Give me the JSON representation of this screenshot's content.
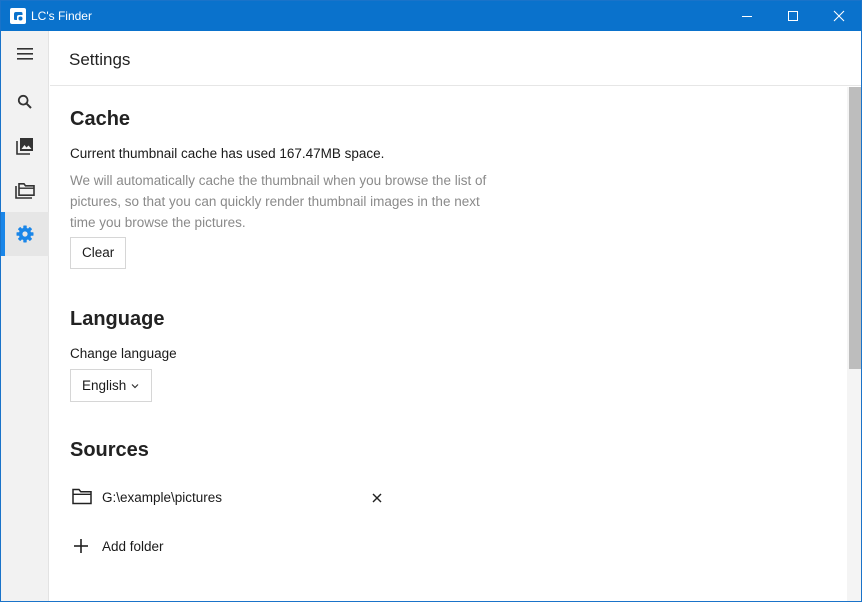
{
  "window": {
    "title": "LC's Finder",
    "controls": {
      "minimize": "minimize-icon",
      "maximize": "maximize-icon",
      "close": "close-icon"
    }
  },
  "sidebar": {
    "items": [
      {
        "id": "menu",
        "icon": "hamburger-icon",
        "active": false
      },
      {
        "id": "search",
        "icon": "search-icon",
        "active": false
      },
      {
        "id": "images",
        "icon": "images-icon",
        "active": false
      },
      {
        "id": "folders",
        "icon": "folders-icon",
        "active": false
      },
      {
        "id": "settings",
        "icon": "gear-icon",
        "active": true
      }
    ],
    "accent_color": "#1a86e8"
  },
  "header": {
    "title": "Settings"
  },
  "cache": {
    "heading": "Cache",
    "usage_text": "Current thumbnail cache has used 167.47MB space.",
    "description": "We will automatically cache the thumbnail when you browse the list of pictures, so that you can quickly render thumbnail images in the next time you browse the pictures.",
    "clear_label": "Clear"
  },
  "language": {
    "heading": "Language",
    "label": "Change language",
    "selected": "English"
  },
  "sources": {
    "heading": "Sources",
    "items": [
      {
        "path": "G:\\example\\pictures"
      }
    ],
    "add_label": "Add folder"
  },
  "colors": {
    "titlebar": "#0a72cc",
    "accent": "#1a86e8"
  }
}
